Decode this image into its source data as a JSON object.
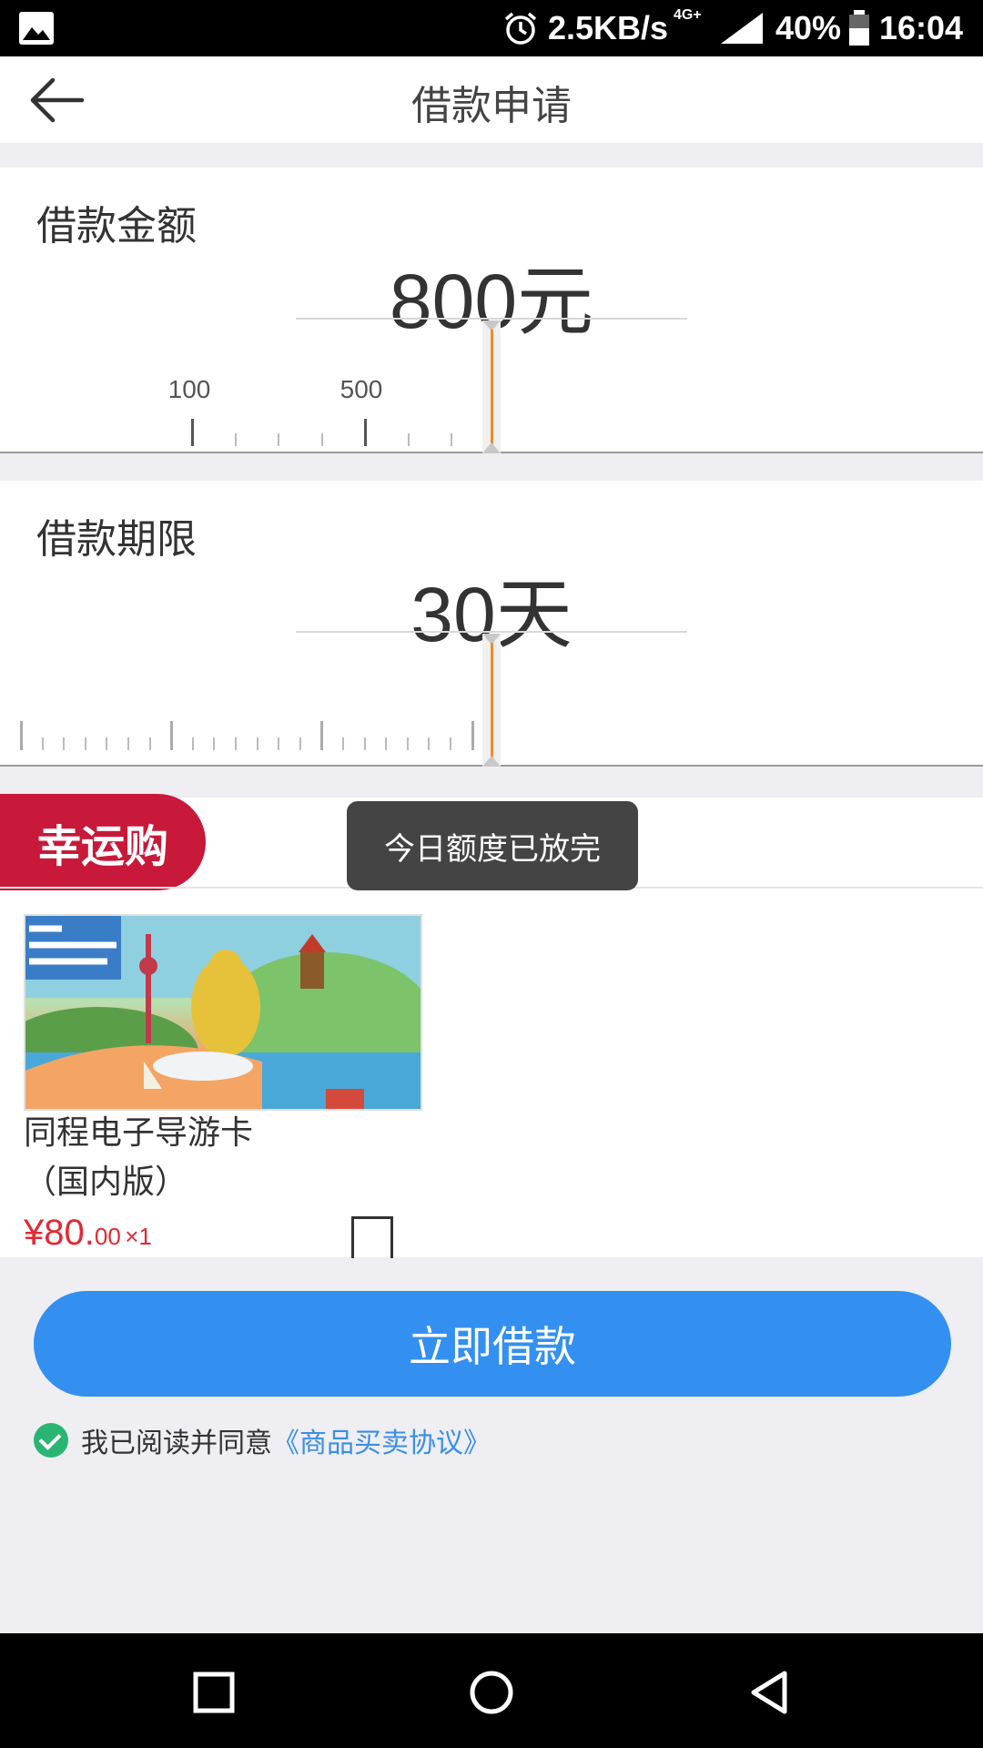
{
  "status_bar": {
    "speed": "2.5KB/s",
    "network": "4G+",
    "battery": "40%",
    "time": "16:04",
    "icons": [
      "image-icon",
      "alarm-icon",
      "signal-icon",
      "battery-icon"
    ]
  },
  "header": {
    "title": "借款申请",
    "back_icon": "arrow-left-icon"
  },
  "amount": {
    "label": "借款金额",
    "value": "800元",
    "tick_labels": [
      "100",
      "500"
    ]
  },
  "term": {
    "label": "借款期限",
    "value": "30天"
  },
  "lucky": {
    "badge": "幸运购",
    "toast": "今日额度已放完",
    "product": {
      "name": "同程电子导游卡（国内版）",
      "price_main": "¥80.",
      "price_cents": "00",
      "quantity": "×1",
      "image_text": "全国 手机导游"
    }
  },
  "submit": {
    "label": "立即借款"
  },
  "agreement": {
    "text": "我已阅读并同意",
    "link": "《商品买卖协议》",
    "checked": true,
    "accent": "#2bb573"
  },
  "colors": {
    "primary": "#3390f0",
    "badge": "#c8193a",
    "indicator": "#f08a2c",
    "price": "#e12a35"
  }
}
